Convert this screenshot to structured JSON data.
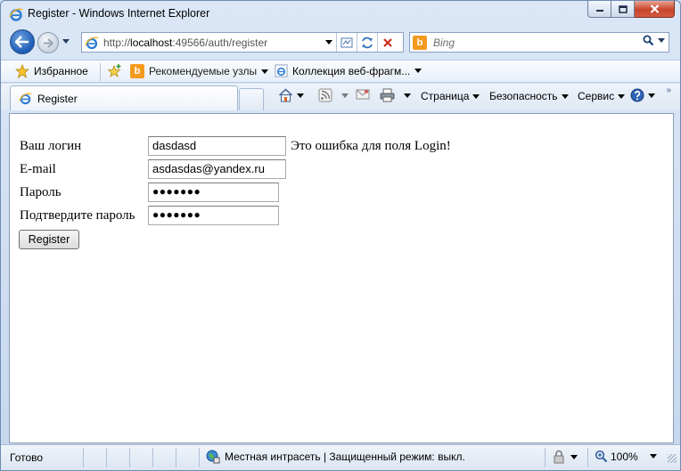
{
  "window": {
    "title": "Register - Windows Internet Explorer"
  },
  "address": {
    "url_prefix": "http://",
    "url_host": "localhost",
    "url_rest": ":49566/auth/register"
  },
  "search": {
    "placeholder": "Bing"
  },
  "favorites": {
    "favorites_label": "Избранное",
    "suggested_sites": "Рекомендуемые узлы",
    "web_slice_gallery": "Коллекция веб-фрагм..."
  },
  "tab": {
    "label": "Register"
  },
  "commandbar": {
    "page": "Страница",
    "safety": "Безопасность",
    "tools": "Сервис"
  },
  "form": {
    "login_label": "Ваш логин",
    "login_value": "dasdasd",
    "login_error": "Это ошибка для поля Login!",
    "email_label": "E-mail",
    "email_value": "asdasdas@yandex.ru",
    "password_label": "Пароль",
    "password_value": "●●●●●●●",
    "confirm_label": "Подтвердите пароль",
    "confirm_value": "●●●●●●●",
    "submit_label": "Register"
  },
  "status": {
    "state": "Готово",
    "zone": "Местная интрасеть | Защищенный режим: выкл.",
    "zoom": "100%"
  },
  "colors": {
    "chrome_blue": "#cfdcee",
    "back_button": "#1d5bb4",
    "bing_orange": "#f59a1d",
    "close_red": "#c7452c"
  },
  "icons": [
    "ie-icon",
    "minimize-icon",
    "maximize-icon",
    "close-icon",
    "back-arrow-icon",
    "forward-arrow-icon",
    "compatibility-icon",
    "refresh-icon",
    "stop-icon",
    "bing-icon",
    "search-icon",
    "favorites-star-icon",
    "add-favorites-icon",
    "home-icon",
    "rss-icon",
    "mail-icon",
    "print-icon",
    "help-icon",
    "globe-zone-icon",
    "zoom-icon"
  ]
}
